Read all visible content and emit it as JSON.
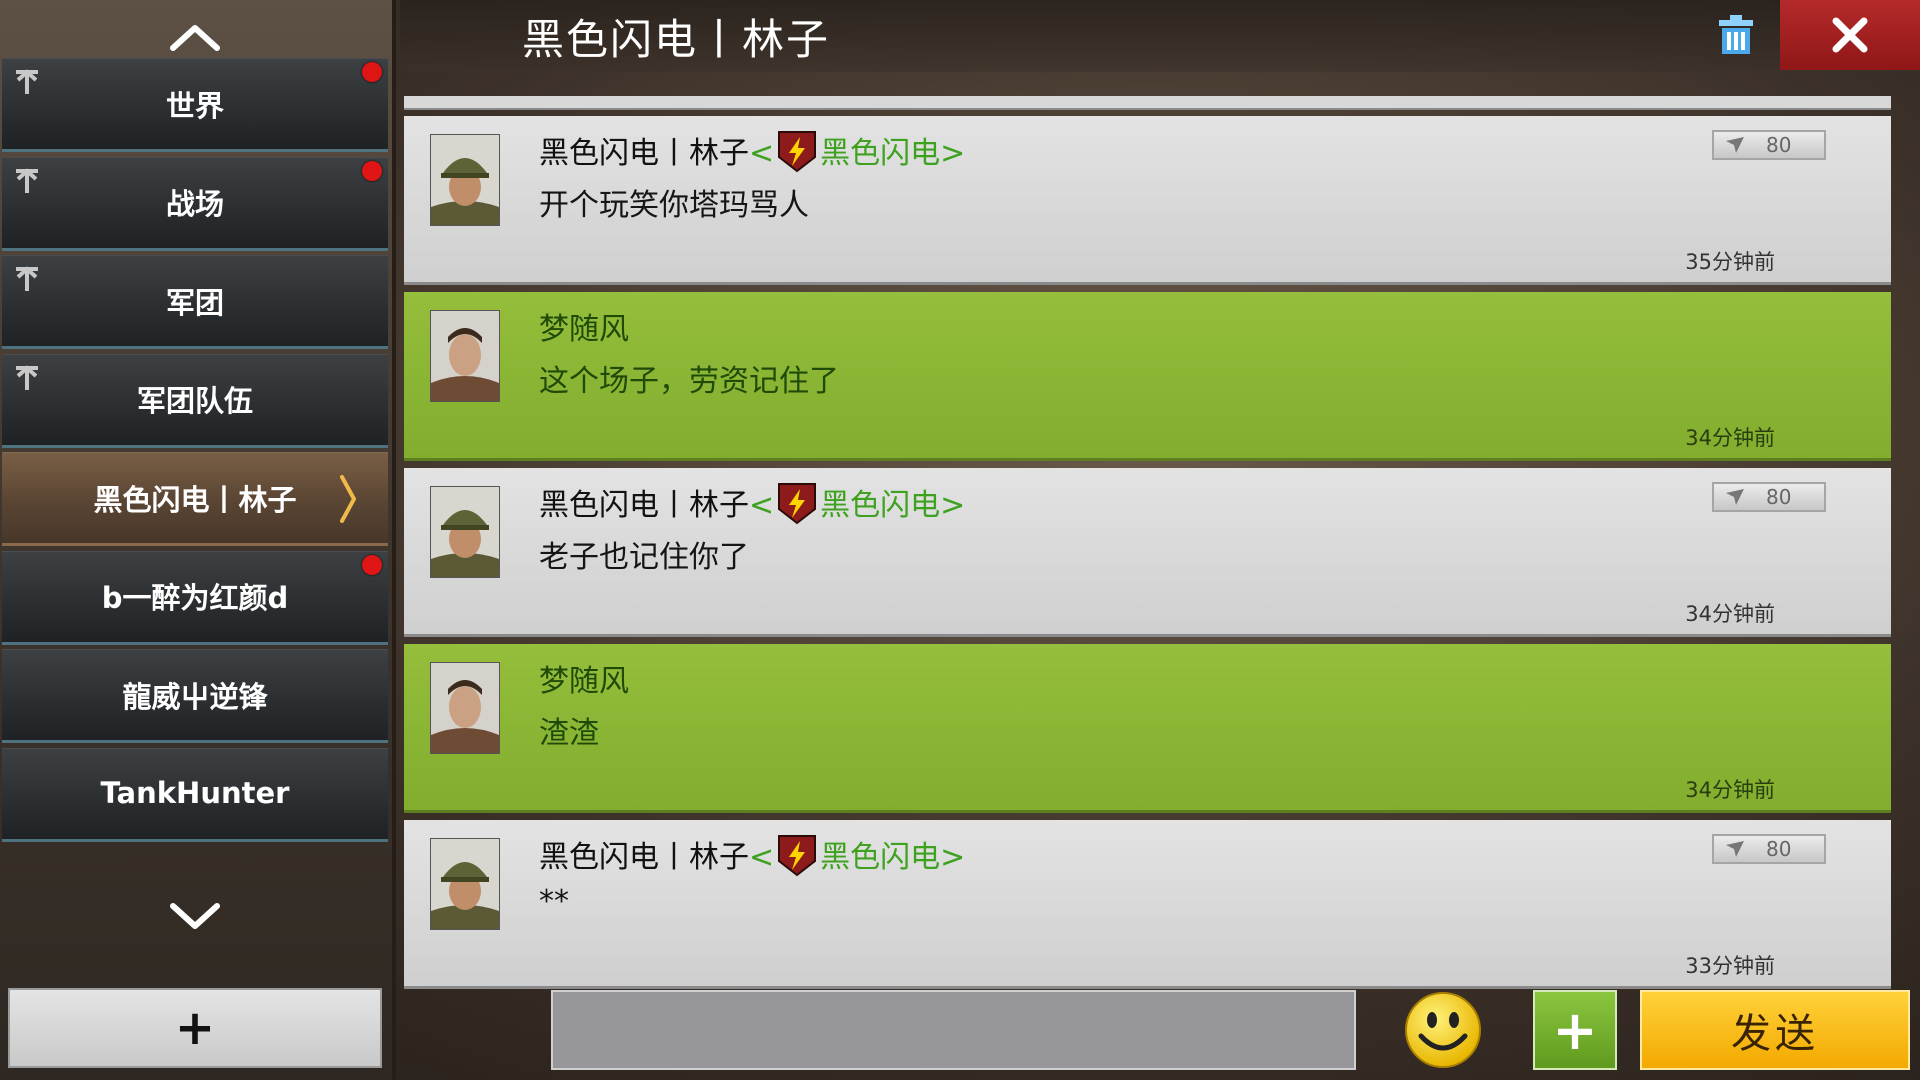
{
  "header": {
    "title": "黑色闪电丨林子"
  },
  "sidebar": {
    "channels": [
      {
        "label": "世界",
        "pinned": true,
        "unread": true
      },
      {
        "label": "战场",
        "pinned": true,
        "unread": true
      },
      {
        "label": "军团",
        "pinned": true,
        "unread": false
      },
      {
        "label": "军团队伍",
        "pinned": true,
        "unread": false
      },
      {
        "label": "黑色闪电丨林子",
        "pinned": false,
        "unread": false,
        "active": true
      },
      {
        "label": "b一醉为红颜d",
        "pinned": false,
        "unread": true
      },
      {
        "label": "龍威屮逆锋",
        "pinned": false,
        "unread": false
      },
      {
        "label": "TankHunter",
        "pinned": false,
        "unread": false
      }
    ],
    "add_label": "+"
  },
  "messages": [
    {
      "sender": "黑色闪电丨林子",
      "guild_open": "<",
      "guild": "黑色闪电",
      "guild_close": ">",
      "text": "开个玩笑你塔玛骂人",
      "time": "35分钟前",
      "level": "80",
      "mine": false
    },
    {
      "sender": "梦随风",
      "text": "这个场子，劳资记住了",
      "time": "34分钟前",
      "mine": true
    },
    {
      "sender": "黑色闪电丨林子",
      "guild_open": "<",
      "guild": "黑色闪电",
      "guild_close": ">",
      "text": "老子也记住你了",
      "time": "34分钟前",
      "level": "80",
      "mine": false
    },
    {
      "sender": "梦随风",
      "text": "渣渣",
      "time": "34分钟前",
      "mine": true
    },
    {
      "sender": "黑色闪电丨林子",
      "guild_open": "<",
      "guild": "黑色闪电",
      "guild_close": ">",
      "text": "**",
      "time": "33分钟前",
      "level": "80",
      "mine": false
    }
  ],
  "composer": {
    "input_value": "",
    "plus_label": "+",
    "send_label": "发送"
  },
  "colors": {
    "mine_bubble": "#8bb634",
    "other_bubble": "#d9d9d9",
    "guild_text": "#3ea11f",
    "close_button": "#a52020",
    "send_button": "#f7bb12",
    "unread_dot": "#e01515"
  },
  "icons": [
    "chevron-up-icon",
    "chevron-down-icon",
    "pin-icon",
    "trash-icon",
    "close-icon",
    "lightning-badge-icon",
    "signal-icon",
    "smiley-icon"
  ]
}
